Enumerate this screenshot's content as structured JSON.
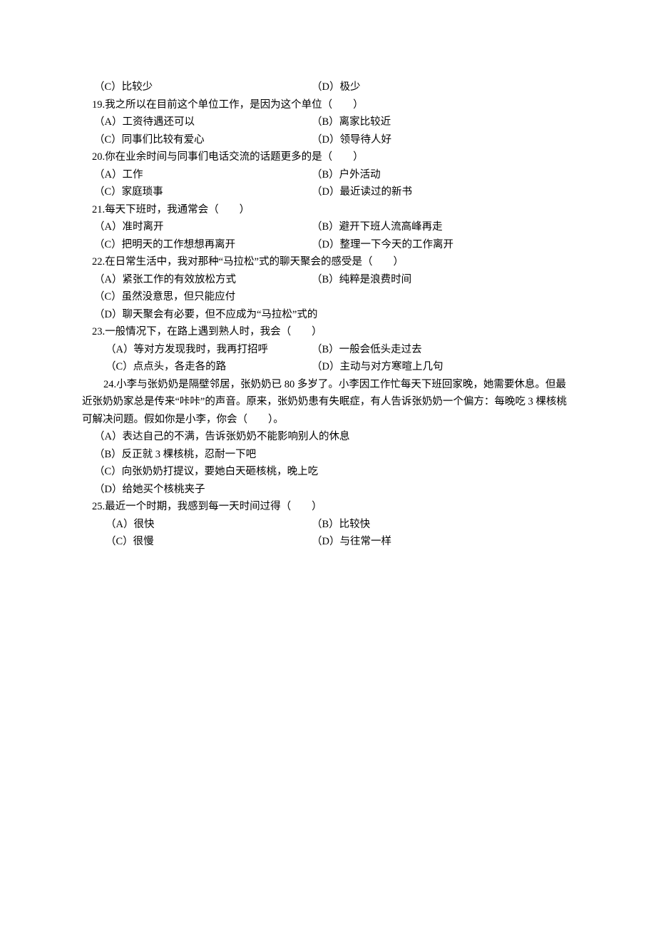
{
  "q18": {
    "c": "（C）比较少",
    "d": "（D）极少"
  },
  "q19": {
    "stem": "19.我之所以在目前这个单位工作，是因为这个单位（　　）",
    "a": "（A）工资待遇还可以",
    "b": "（B）离家比较近",
    "c": "（C）同事们比较有爱心",
    "d": "（D）领导待人好"
  },
  "q20": {
    "stem": "20.你在业余时间与同事们电话交流的话题更多的是（　　）",
    "a": "（A）工作",
    "b": "（B）户外活动",
    "c": "（C）家庭琐事",
    "d": "（D）最近读过的新书"
  },
  "q21": {
    "stem": "21.每天下班时，我通常会（　　）",
    "a": "（A）准时离开",
    "b": "（B）避开下班人流高峰再走",
    "c": "（C）把明天的工作想想再离开",
    "d": "（D）整理一下今天的工作离开"
  },
  "q22": {
    "stem": "22.在日常生活中，我对那种“马拉松”式的聊天聚会的感受是（　　）",
    "a": "（A）紧张工作的有效放松方式",
    "b": "（B）纯粹是浪费时间",
    "c": "（C）虽然没意思，但只能应付",
    "d": "（D）聊天聚会有必要，但不应成为“马拉松”式的"
  },
  "q23": {
    "stem": "23.一般情况下，在路上遇到熟人时，我会（　　）",
    "a": "（A）等对方发现我时，我再打招呼",
    "b": "（B）一般会低头走过去",
    "c": "（C）点点头，各走各的路",
    "d": "（D）主动与对方寒暄上几句"
  },
  "q24": {
    "stem": "24.小李与张奶奶是隔壁邻居，张奶奶已 80 多岁了。小李因工作忙每天下班回家晚，她需要休息。但最近张奶奶家总是传来“咔咔”的声音。原来，张奶奶患有失眠症，有人告诉张奶奶一个偏方：每晚吃 3 棵核桃可解决问题。假如你是小李，你会（　　）。",
    "a": "（A）表达自己的不满，告诉张奶奶不能影响别人的休息",
    "b": "（B）反正就 3 棵核桃，忍耐一下吧",
    "c": "（C）向张奶奶打提议，要她白天砸核桃，晚上吃",
    "d": "（D）给她买个核桃夹子"
  },
  "q25": {
    "stem": "25.最近一个时期，我感到每一天时间过得（　　）",
    "a": "（A）很快",
    "b": "（B）比较快",
    "c": "（C）很慢",
    "d": "（D）与往常一样"
  }
}
